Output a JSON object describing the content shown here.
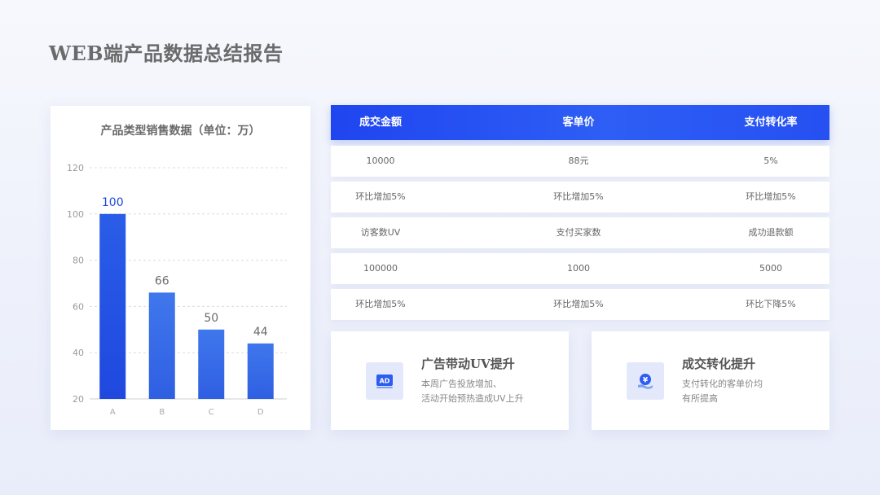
{
  "page": {
    "title": "WEB端产品数据总结报告"
  },
  "chart_data": {
    "type": "bar",
    "title": "产品类型销售数据（单位：万）",
    "categories": [
      "A",
      "B",
      "C",
      "D"
    ],
    "values": [
      100,
      66,
      50,
      44
    ],
    "data_labels": [
      "100",
      "66",
      "50",
      "44"
    ],
    "yticks": [
      20,
      40,
      60,
      80,
      100,
      120
    ],
    "ylim": [
      20,
      120
    ],
    "grid": true,
    "bar_color": "#2b5bec"
  },
  "table": {
    "headers": [
      "成交金额",
      "客单价",
      "支付转化率"
    ],
    "rows": [
      [
        "10000",
        "88元",
        "5%"
      ],
      [
        "环比增加5%",
        "环比增加5%",
        "环比增加5%"
      ],
      [
        "访客数UV",
        "支付买家数",
        "成功退款额"
      ],
      [
        "100000",
        "1000",
        "5000"
      ],
      [
        "环比增加5%",
        "环比增加5%",
        "环比下降5%"
      ]
    ]
  },
  "cards": [
    {
      "title": "广告带动UV提升",
      "desc_line1": "本周广告投放增加、",
      "desc_line2": "活动开始预热造成UV上升",
      "icon": "ad-icon",
      "icon_text": "AD"
    },
    {
      "title": "成交转化提升",
      "desc_line1": "支付转化的客单价均",
      "desc_line2": "有所提高",
      "icon": "yen-hand-icon",
      "icon_text": "¥"
    }
  ],
  "colors": {
    "accent": "#2050f0",
    "background": "#f3f5fc"
  }
}
